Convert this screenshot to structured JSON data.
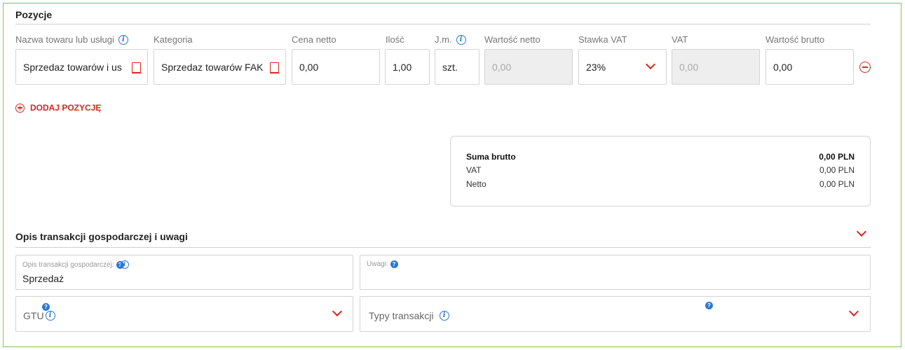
{
  "positions": {
    "title": "Pozycje",
    "columns": {
      "name": "Nazwa towaru lub usługi",
      "category": "Kategoria",
      "net_price": "Cena netto",
      "quantity": "Ilość",
      "unit": "J.m.",
      "net_value": "Wartość netto",
      "vat_rate": "Stawka VAT",
      "vat": "VAT",
      "gross_value": "Wartość brutto"
    },
    "row": {
      "name": "Sprzedaz towarów i us",
      "category": "Sprzedaz towarów FAK",
      "net_price": "0,00",
      "quantity": "1,00",
      "unit": "szt.",
      "net_value": "0,00",
      "vat_rate": "23%",
      "vat": "0,00",
      "gross_value": "0,00"
    },
    "add_label": "DODAJ POZYCJĘ"
  },
  "summary": {
    "gross_label": "Suma brutto",
    "gross_value": "0,00 PLN",
    "vat_label": "VAT",
    "vat_value": "0,00 PLN",
    "net_label": "Netto",
    "net_value": "0,00 PLN"
  },
  "description": {
    "title": "Opis transakcji gospodarczej i uwagi",
    "transaction_label": "Opis transakcji gospodarczej:",
    "transaction_value": "Sprzedaż",
    "notes_label": "Uwagi:",
    "gtu_label": "GTU",
    "types_label": "Typy transakcji"
  },
  "icons": {
    "info": "i",
    "help": "?"
  },
  "colors": {
    "accent": "#d9261c",
    "info": "#2b78d4",
    "frame": "#7ec84a"
  }
}
